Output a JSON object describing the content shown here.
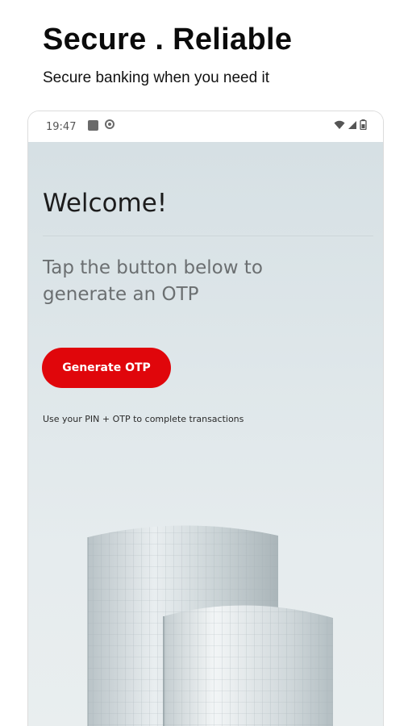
{
  "promo": {
    "headline": "Secure . Reliable",
    "subheadline": "Secure banking when you need it"
  },
  "status_bar": {
    "time": "19:47",
    "left_icons": [
      "app-notification-icon",
      "sync-icon"
    ],
    "right_icons": [
      "wifi-icon",
      "signal-icon",
      "battery-icon"
    ]
  },
  "screen": {
    "welcome": "Welcome!",
    "instruction": "Tap the button below to generate an OTP",
    "generate_button": "Generate OTP",
    "hint": "Use your PIN + OTP to complete transactions",
    "accent_color": "#e0060b"
  }
}
